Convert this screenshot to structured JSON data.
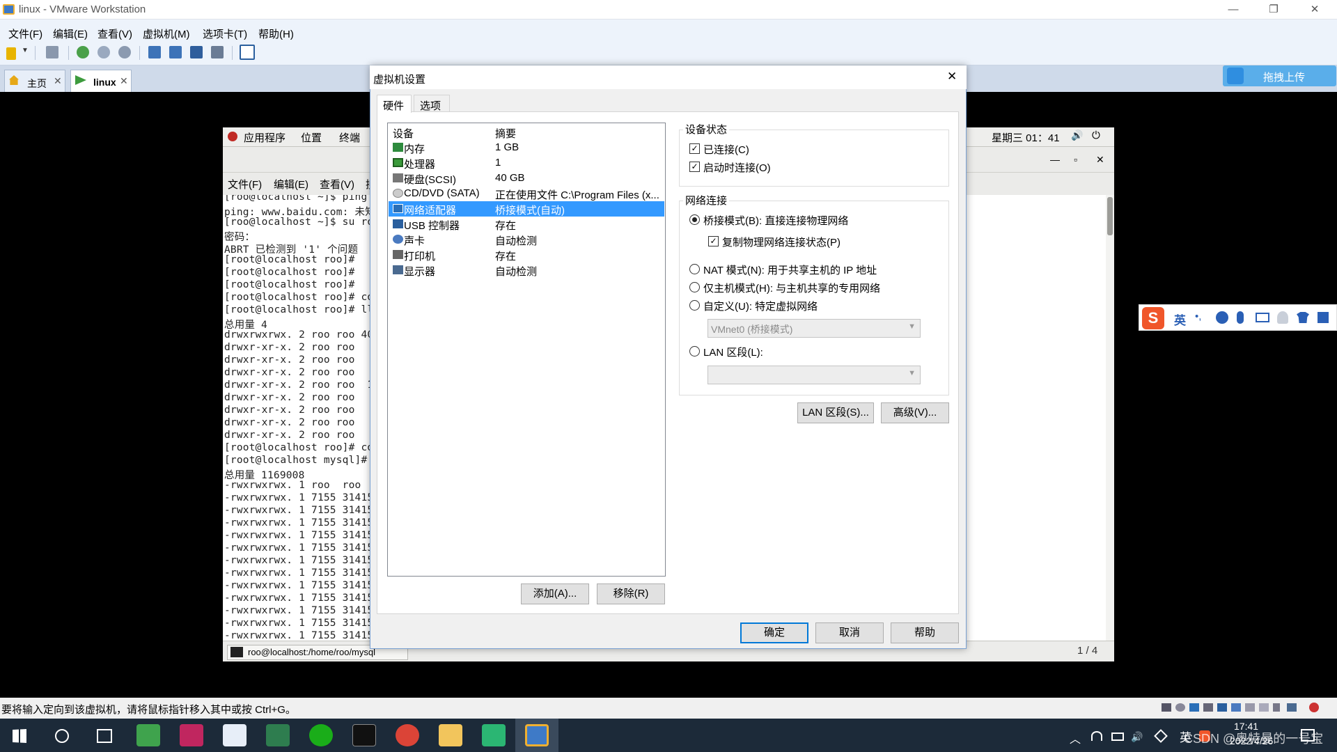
{
  "window": {
    "title": "linux - VMware Workstation",
    "min": "—",
    "restore": "❐",
    "close": "✕"
  },
  "menu": [
    "文件(F)",
    "编辑(E)",
    "查看(V)",
    "虚拟机(M)",
    "选项卡(T)",
    "帮助(H)"
  ],
  "tabs": [
    {
      "label": "主页",
      "close": "✕"
    },
    {
      "label": "linux",
      "close": "✕"
    }
  ],
  "upload": {
    "label": "拖拽上传"
  },
  "guest": {
    "panel": [
      "应用程序",
      "位置",
      "终端"
    ],
    "clock": "星期三 01：41",
    "term_menu": [
      "文件(F)",
      "编辑(E)",
      "查看(V)",
      "搜"
    ],
    "win_ctl": [
      "—",
      "▫",
      "✕"
    ],
    "lines": [
      "[roo@localhost ~]$ ping",
      "ping: www.baidu.com: 未知",
      "[roo@localhost ~]$ su ro",
      "密码：",
      "ABRT 已检测到 '1' 个问题",
      "[root@localhost roo]# ",
      "[root@localhost roo]# ",
      "[root@localhost roo]# ",
      "[root@localhost roo]# cd",
      "[root@localhost roo]# ll",
      "总用量 4",
      "drwxrwxrwx. 2 roo roo 40",
      "drwxr-xr-x. 2 roo roo",
      "drwxr-xr-x. 2 roo roo",
      "drwxr-xr-x. 2 roo roo",
      "drwxr-xr-x. 2 roo roo  1",
      "drwxr-xr-x. 2 roo roo",
      "drwxr-xr-x. 2 roo roo",
      "drwxr-xr-x. 2 roo roo",
      "drwxr-xr-x. 2 roo roo",
      "[root@localhost roo]# cd",
      "[root@localhost mysql]# ",
      "总用量 1169008",
      "-rwxrwxrwx. 1 roo  roo",
      "-rwxrwxrwx. 1 7155 31415",
      "-rwxrwxrwx. 1 7155 31415",
      "-rwxrwxrwx. 1 7155 31415",
      "-rwxrwxrwx. 1 7155 31415",
      "-rwxrwxrwx. 1 7155 31415",
      "-rwxrwxrwx. 1 7155 31415",
      "-rwxrwxrwx. 1 7155 31415",
      "-rwxrwxrwx. 1 7155 31415",
      "-rwxrwxrwx. 1 7155 31415",
      "-rwxrwxrwx. 1 7155 31415",
      "-rwxrwxrwx. 1 7155 31415",
      "-rwxrwxrwx. 1 7155 31415"
    ],
    "taskbar_item": "roo@localhost:/home/roo/mysql",
    "workspace": "1 / 4"
  },
  "dialog": {
    "title": "虚拟机设置",
    "close": "✕",
    "tabs": [
      "硬件",
      "选项"
    ],
    "col_device": "设备",
    "col_summary": "摘要",
    "devices": [
      {
        "name": "内存",
        "summary": "1 GB",
        "icon": "memory-icon",
        "color": "#2e8b3e"
      },
      {
        "name": "处理器",
        "summary": "1",
        "icon": "cpu-icon",
        "color": "#3a9a3a"
      },
      {
        "name": "硬盘(SCSI)",
        "summary": "40 GB",
        "icon": "harddisk-icon",
        "color": "#777777"
      },
      {
        "name": "CD/DVD (SATA)",
        "summary": "正在使用文件 C:\\Program Files (x...",
        "icon": "cdrom-icon",
        "color": "#999999"
      },
      {
        "name": "网络适配器",
        "summary": "桥接模式(自动)",
        "icon": "network-adapter-icon",
        "color": "#2a6fb8"
      },
      {
        "name": "USB 控制器",
        "summary": "存在",
        "icon": "usb-icon",
        "color": "#2a5f9e"
      },
      {
        "name": "声卡",
        "summary": "自动检测",
        "icon": "sound-icon",
        "color": "#4a7ac0"
      },
      {
        "name": "打印机",
        "summary": "存在",
        "icon": "printer-icon",
        "color": "#666666"
      },
      {
        "name": "显示器",
        "summary": "自动检测",
        "icon": "monitor-icon",
        "color": "#4a6a90"
      }
    ],
    "add_btn": "添加(A)...",
    "remove_btn": "移除(R)",
    "device_status": {
      "title": "设备状态",
      "connected": "已连接(C)",
      "connect_on_start": "启动时连接(O)"
    },
    "net": {
      "title": "网络连接",
      "bridged": "桥接模式(B): 直接连接物理网络",
      "replicate": "复制物理网络连接状态(P)",
      "nat": "NAT 模式(N): 用于共享主机的 IP 地址",
      "hostonly": "仅主机模式(H): 与主机共享的专用网络",
      "custom": "自定义(U): 特定虚拟网络",
      "vmnet": "VMnet0 (桥接模式)",
      "lan": "LAN 区段(L):"
    },
    "lan_seg_btn": "LAN 区段(S)...",
    "advanced_btn": "高级(V)...",
    "ok": "确定",
    "cancel": "取消",
    "help": "帮助"
  },
  "statusbar": {
    "text": "要将输入定向到该虚拟机，请将鼠标指针移入其中或按 Ctrl+G。"
  },
  "ime": {
    "lang": "英"
  },
  "taskbar": {
    "lang": "英",
    "time": "17:41",
    "date": "2022/4/26",
    "watermark": "CSDN @奥特曼的一号宝"
  }
}
